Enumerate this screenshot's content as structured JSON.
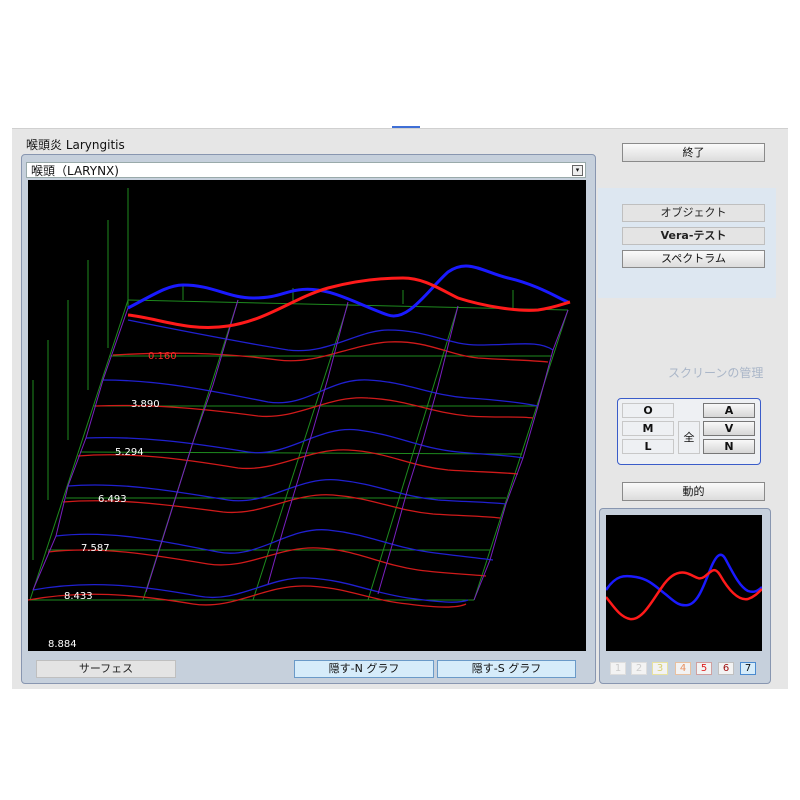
{
  "window": {
    "title": "喉頭炎 Laryngitis",
    "view_title": "喉頭（LARYNX)"
  },
  "plot_labels": [
    "0.160",
    "3.890",
    "5.294",
    "6.493",
    "7.587",
    "8.433",
    "8.884"
  ],
  "bottom_buttons": {
    "surface": "サーフェス",
    "hide_n": "隠す-N グラフ",
    "hide_s": "隠す-S グラフ"
  },
  "right": {
    "end": "終了",
    "object": "オブジェクト",
    "vera_test": "Vera-テスト",
    "spectrum": "スペクトラム",
    "screen_management": "スクリーンの管理",
    "left_keys": [
      "O",
      "M",
      "L"
    ],
    "all_key": "全",
    "right_keys": [
      "A",
      "V",
      "N"
    ],
    "dynamic": "動的"
  },
  "level_swatches": [
    "1",
    "2",
    "3",
    "4",
    "5",
    "6",
    "7"
  ],
  "colors": {
    "red_series": "#ff1a1a",
    "blue_series": "#1a1aff",
    "grid": "#1e8a1e",
    "accent": "#3a5cc9"
  }
}
